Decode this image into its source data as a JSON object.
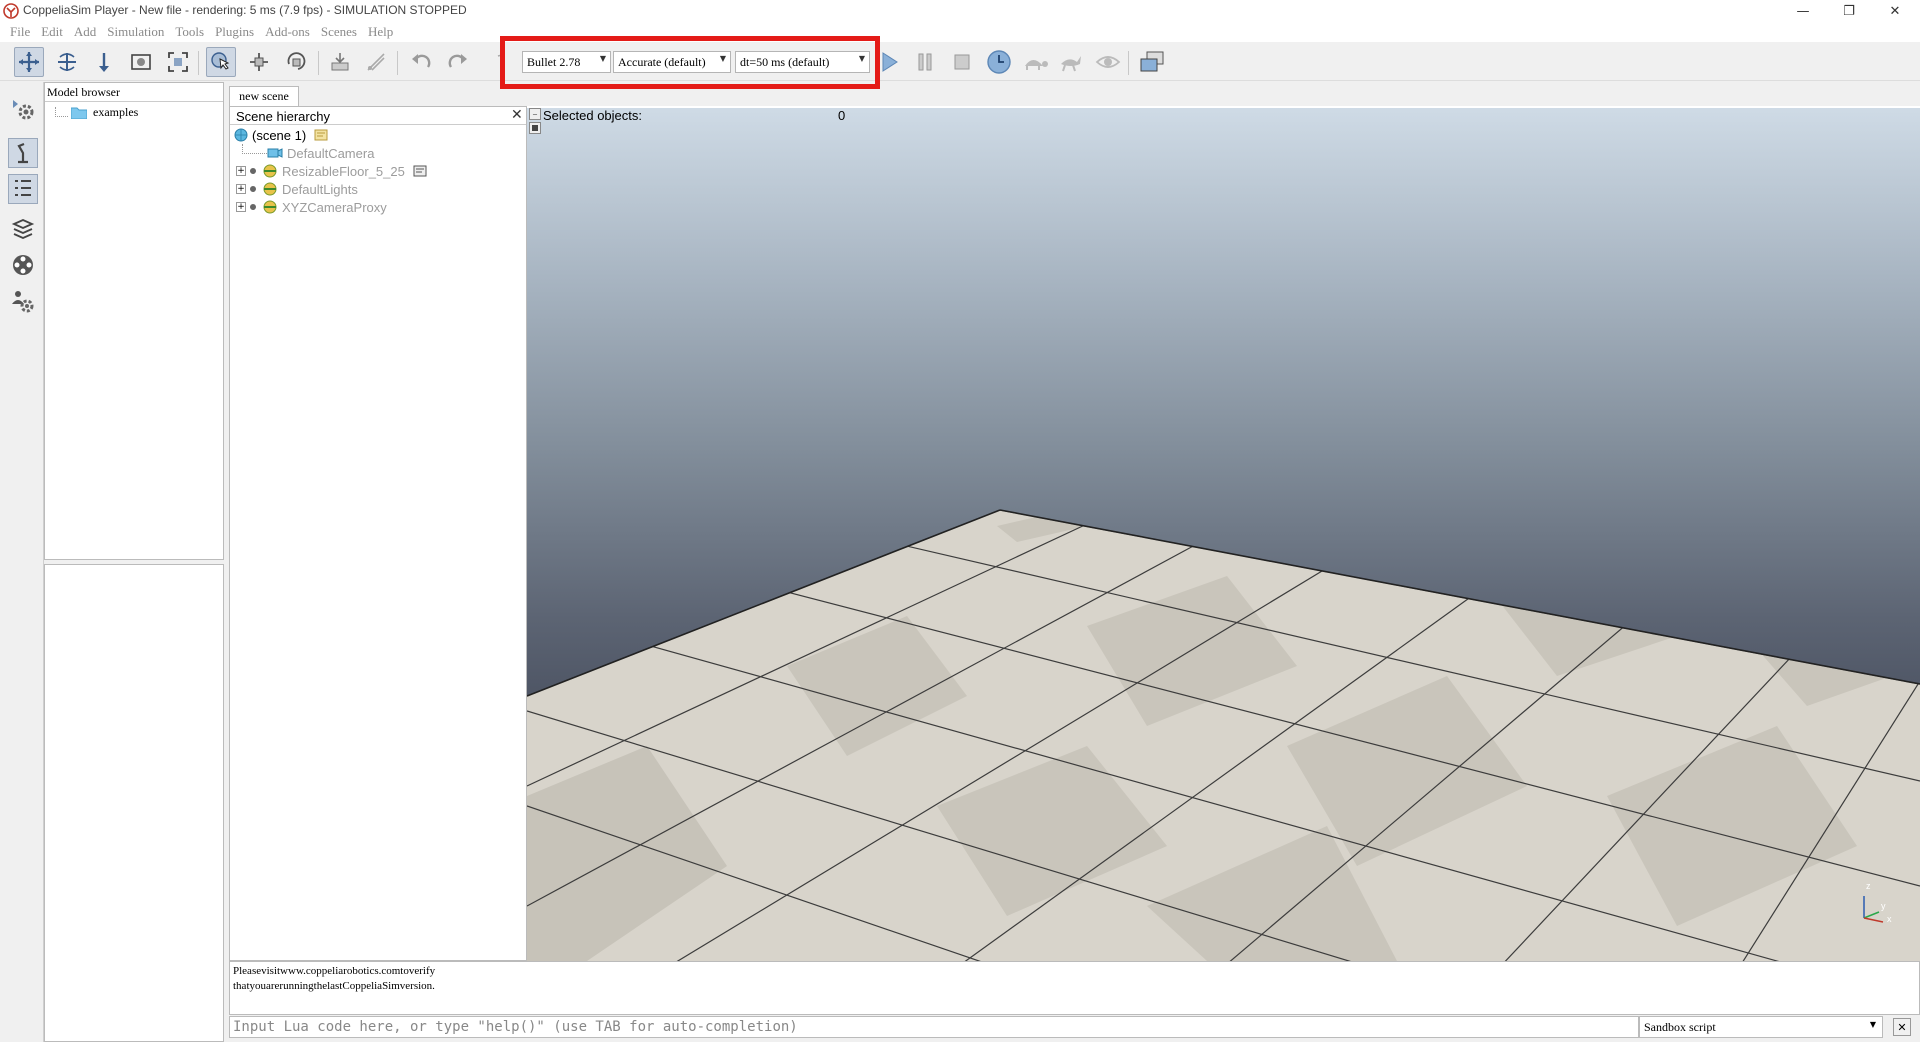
{
  "window": {
    "title": "CoppeliaSim Player - New file - rendering: 5 ms (7.9 fps) - SIMULATION STOPPED",
    "minimize_glyph": "—",
    "restore_glyph": "❐",
    "close_glyph": "✕"
  },
  "menubar": {
    "items": [
      "File",
      "Edit",
      "Add",
      "Simulation",
      "Tools",
      "Plugins",
      "Add-ons",
      "Scenes",
      "Help"
    ]
  },
  "toolbar": {
    "engine": "Bullet 2.78",
    "accuracy": "Accurate (default)",
    "dt": "dt=50 ms (default)",
    "dropdown_glyph": "▼",
    "highlight_color": "#e41b17",
    "icons": [
      "move-camera-icon",
      "rotate-camera-icon",
      "shift-camera-icon",
      "camera-angle-icon",
      "fit-to-view-icon",
      "click-selection-icon",
      "object-shift-icon",
      "object-rotate-icon",
      "assemble-icon",
      "transfer-dna-icon",
      "undo-icon",
      "redo-icon",
      "dynamics-icon",
      "start-simulation-icon",
      "pause-simulation-icon",
      "stop-simulation-icon",
      "real-time-icon",
      "slow-down-icon",
      "speed-up-icon",
      "visualization-icon",
      "toggle-page-icon"
    ]
  },
  "model_browser": {
    "title": "Model browser",
    "items": [
      {
        "label": "examples"
      }
    ]
  },
  "scene_tab": {
    "label": "new scene"
  },
  "scene_hierarchy": {
    "title": "Scene hierarchy",
    "close_glyph": "✕",
    "root": "(scene 1)",
    "items": [
      {
        "label": "DefaultCamera",
        "expandable": false
      },
      {
        "label": "ResizableFloor_5_25",
        "expandable": true
      },
      {
        "label": "DefaultLights",
        "expandable": true
      },
      {
        "label": "XYZCameraProxy",
        "expandable": true
      }
    ]
  },
  "viewport": {
    "selected_label": "Selected objects:",
    "selected_count": "0",
    "axis_labels": {
      "z": "z",
      "y": "y",
      "x": "x"
    }
  },
  "console": {
    "line1": "Pleasevisitwww.coppeliarobotics.comtoverify",
    "line2": "thatyouarerunningthelastCoppeliaSimversion."
  },
  "lua_input": {
    "placeholder": "Input Lua code here, or type \"help()\" (use TAB for auto-completion)"
  },
  "script_select": {
    "value": "Sandbox script",
    "close_glyph": "✕"
  }
}
